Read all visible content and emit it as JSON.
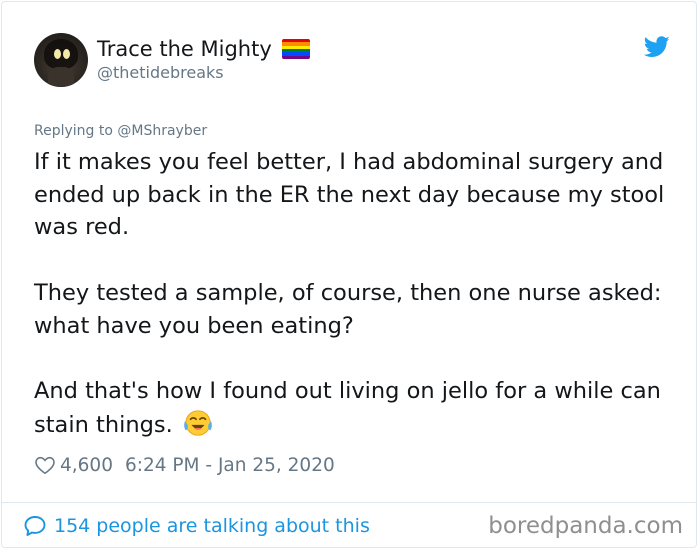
{
  "user": {
    "display_name": "Trace the Mighty",
    "handle": "@thetidebreaks",
    "flag_colors": [
      "#e40303",
      "#ff8c00",
      "#ffed00",
      "#008026",
      "#004dff",
      "#750787"
    ]
  },
  "tweet": {
    "reply_to": "Replying to @MShrayber",
    "paragraphs": [
      "If it makes you feel better, I had abdominal surgery and ended up back in the ER the next day because my stool was red.",
      "They tested a sample, of course, then one nurse asked: what have you been eating?",
      "And that's how I found out living on jello for a while can stain things."
    ],
    "emoji": "face-with-tears-of-joy",
    "likes": "4,600",
    "timestamp": "6:24 PM - Jan 25, 2020"
  },
  "footer": {
    "talk_text": "154 people are talking about this",
    "watermark": "boredpanda.com"
  },
  "colors": {
    "twitter_blue": "#1da1f2",
    "link_blue": "#1b95e0",
    "secondary_text": "#657786",
    "border": "#e1e8ed"
  }
}
